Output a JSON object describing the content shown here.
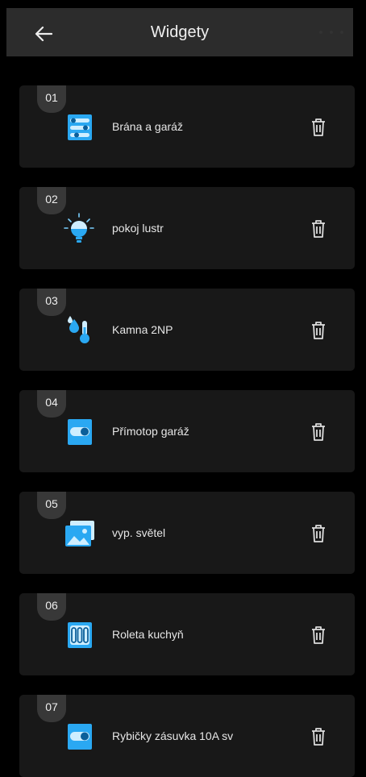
{
  "header": {
    "title": "Widgety",
    "back_icon": "arrow-left-icon",
    "more_icon": "more-dots-icon"
  },
  "colors": {
    "accent": "#2aa8f2",
    "card": "#181818",
    "badge": "#383838",
    "header": "#2c2c2c"
  },
  "widgets": [
    {
      "number": "01",
      "label": "Brána a garáž",
      "icon": "sliders-panel-icon"
    },
    {
      "number": "02",
      "label": "pokoj lustr",
      "icon": "light-bulb-icon"
    },
    {
      "number": "03",
      "label": "Kamna 2NP",
      "icon": "humidity-thermometer-icon"
    },
    {
      "number": "04",
      "label": "Přímotop garáž",
      "icon": "toggle-switch-icon"
    },
    {
      "number": "05",
      "label": "vyp. světel",
      "icon": "image-icon"
    },
    {
      "number": "06",
      "label": "Roleta kuchyň",
      "icon": "blind-panel-icon"
    },
    {
      "number": "07",
      "label": "Rybičky zásuvka 10A sv",
      "icon": "toggle-switch-icon"
    }
  ]
}
